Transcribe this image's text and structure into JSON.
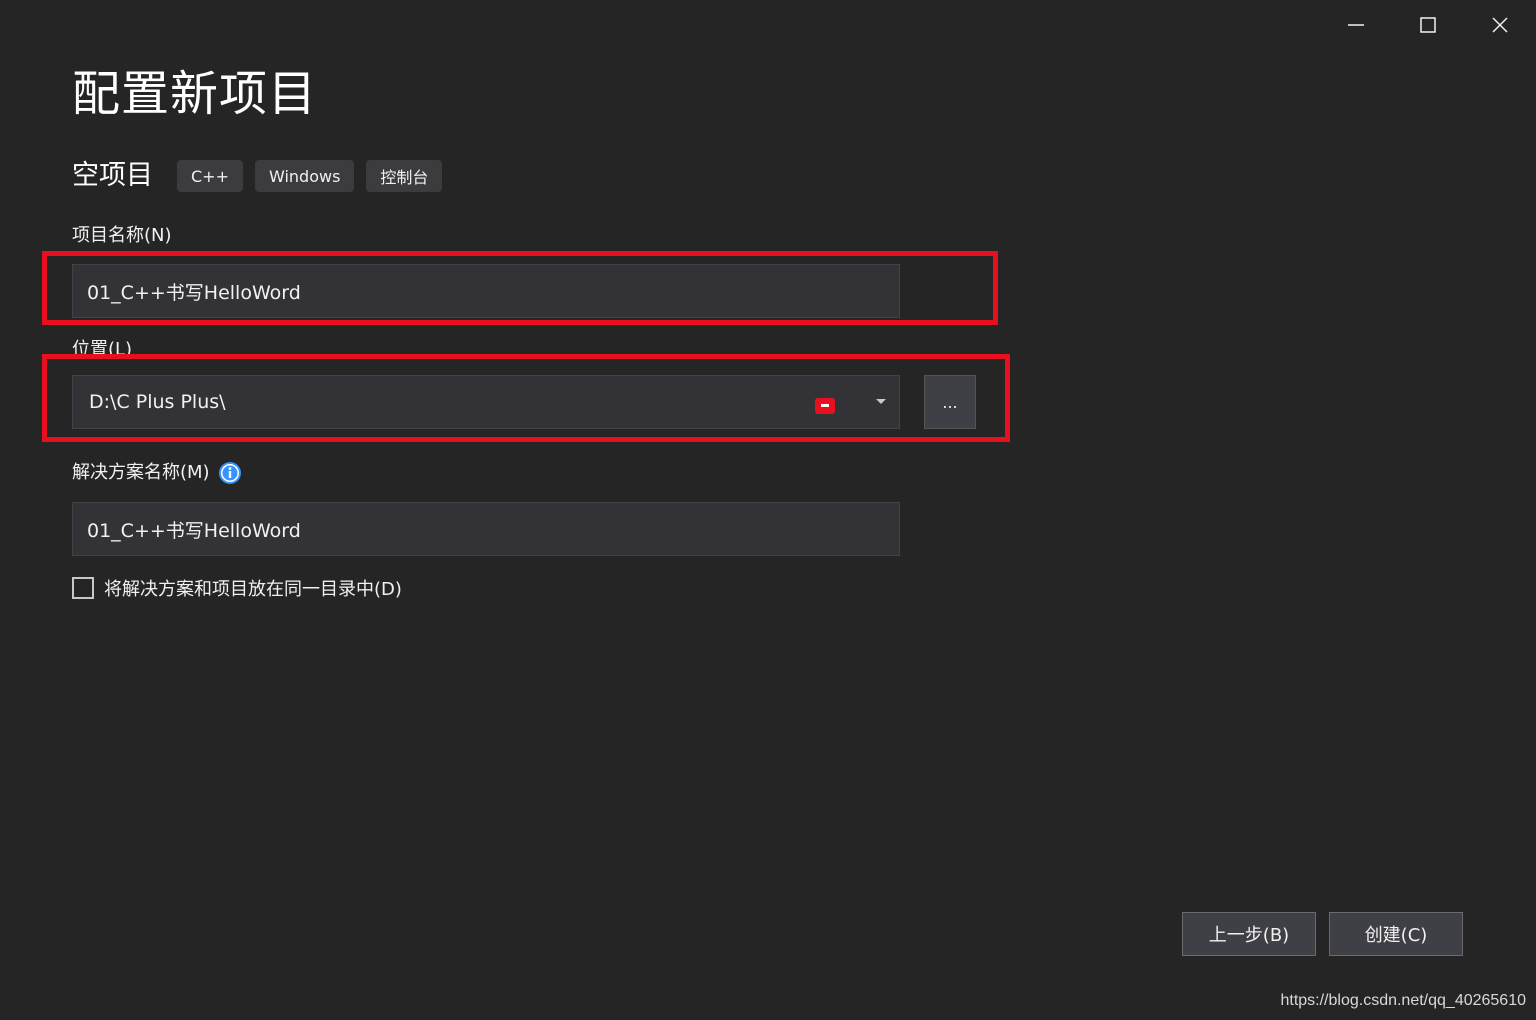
{
  "window": {
    "controls": {
      "minimize_icon": "minimize-icon",
      "maximize_icon": "maximize-icon",
      "close_icon": "close-icon"
    }
  },
  "page": {
    "title": "配置新项目"
  },
  "template": {
    "name": "空项目",
    "tags": [
      "C++",
      "Windows",
      "控制台"
    ]
  },
  "form": {
    "project_name": {
      "label": "项目名称(N)",
      "value": "01_C++书写HelloWord"
    },
    "location": {
      "label": "位置(L)",
      "value": "D:\\C Plus Plus\\",
      "browse_label": "..."
    },
    "solution_name": {
      "label": "解决方案名称(M)",
      "value": "01_C++书写HelloWord",
      "info_icon": "info-icon"
    },
    "same_directory": {
      "label": "将解决方案和项目放在同一目录中(D)",
      "checked": false
    }
  },
  "footer": {
    "back_label": "上一步(B)",
    "create_label": "创建(C)"
  },
  "watermark": "https://blog.csdn.net/qq_40265610",
  "colors": {
    "background": "#252526",
    "input_background": "#333337",
    "highlight": "#e8101c",
    "info_blue": "#3794ff"
  }
}
